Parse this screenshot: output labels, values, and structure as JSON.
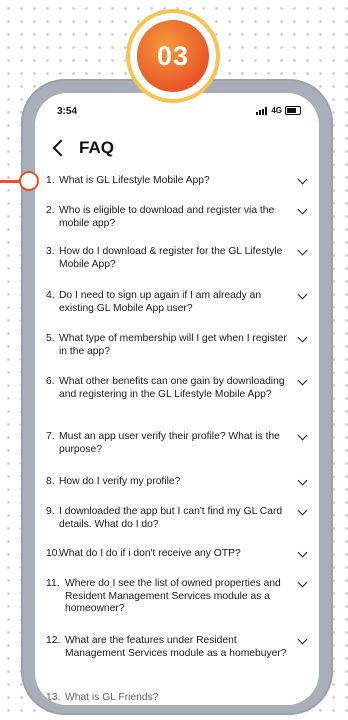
{
  "badge": {
    "number": "03"
  },
  "status_bar": {
    "time": "3:54",
    "network": "4G"
  },
  "header": {
    "title": "FAQ"
  },
  "faq": [
    {
      "num": "1.",
      "question": "What is GL Lifestyle Mobile App?"
    },
    {
      "num": "2.",
      "question": "Who is eligible to download and register via the mobile app?"
    },
    {
      "num": "3.",
      "question": "How do I download & register for the GL Lifestyle Mobile App?"
    },
    {
      "num": "4.",
      "question": "Do I need to sign up again if I am already an existing GL Mobile App user?"
    },
    {
      "num": "5.",
      "question": "What type of membership will I get when I register in the app?"
    },
    {
      "num": "6.",
      "question": "What other benefits can one gain by downloading and registering in the GL Lifestyle Mobile App?"
    },
    {
      "num": "7.",
      "question": "Must an app user verify their profile? What is the purpose?"
    },
    {
      "num": "8.",
      "question": "How do I verify my profile?"
    },
    {
      "num": "9.",
      "question": "I downloaded the app but I can't find my GL Card details. What do I do?"
    },
    {
      "num": "10.",
      "question": "What do I do if i don't receive any OTP?"
    },
    {
      "num": "11.",
      "question": "Where do I see the list of owned properties and Resident Management Services module as a homeowner?"
    },
    {
      "num": "12.",
      "question": "What are the features under Resident Management Services module as a homebuyer?"
    },
    {
      "num": "13.",
      "question": "What is GL Friends?"
    }
  ],
  "colors": {
    "accent": "#e8562a",
    "badge_ring": "#f6c44f",
    "phone_frame": "#a9aeb8"
  }
}
